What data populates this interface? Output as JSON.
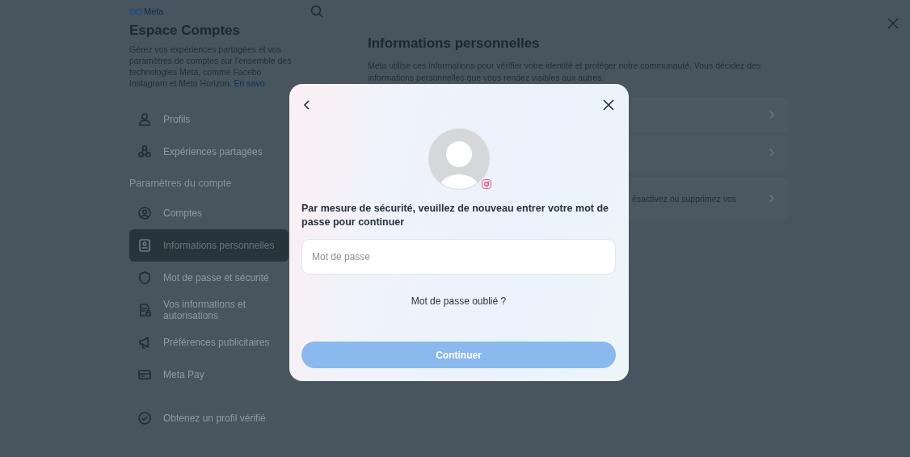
{
  "header": {
    "brand": "Meta"
  },
  "sidebar": {
    "title": "Espace Comptes",
    "description": {
      "lines": [
        "Gérez vos expériences partagées et vos",
        "paramètres de comptes sur l'ensemble des",
        "technologies Meta, comme Facebo",
        "Instagram et Meta Horizon."
      ],
      "link": "En savo"
    },
    "items": [
      {
        "label": "Profils",
        "selected": false
      },
      {
        "label": "Expériences partagées",
        "selected": false
      }
    ],
    "section_title": "Paramètres du compte",
    "settings_items": [
      {
        "label": "Comptes",
        "selected": false
      },
      {
        "label": "Informations personnelles",
        "selected": true
      },
      {
        "label": "Mot de passe et sécurité",
        "selected": false
      },
      {
        "label": "Vos informations et autorisations",
        "selected": false
      },
      {
        "label": "Préférences publicitaires",
        "selected": false
      },
      {
        "label": "Meta Pay",
        "selected": false
      }
    ],
    "verify": {
      "label": "Obtenez un profil vérifié"
    }
  },
  "main": {
    "title": "Informations personnelles",
    "description": "Meta utilise ces informations pour vérifier votre identité et protéger notre communauté. Vous décidez des informations personnelles que vous rendez visibles aux autres.",
    "cards": [
      {
        "kind": "blank"
      },
      {
        "kind": "blank"
      },
      {
        "kind": "text",
        "text": "ésactivez ou supprimez vos"
      }
    ]
  },
  "dialog": {
    "message": "Par mesure de sécurité, veuillez de nouveau entrer votre mot de passe pour continuer",
    "password": {
      "placeholder": "Mot de passe"
    },
    "forgot_link": "Mot de passe oublié ?",
    "submit": {
      "label": "Continuer",
      "disabled": true
    }
  }
}
